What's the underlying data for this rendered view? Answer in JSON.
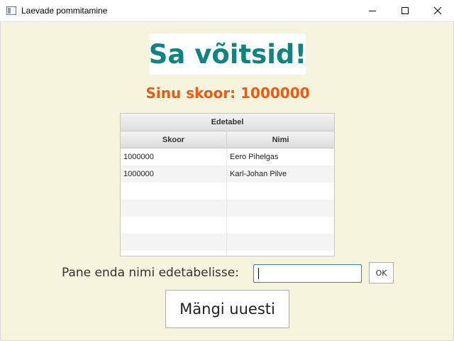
{
  "window": {
    "title": "Laevade pommitamine",
    "icon": "app-window-icon",
    "controls": [
      "minimize-icon",
      "maximize-icon",
      "close-icon"
    ]
  },
  "result": {
    "heading": "Sa võitsid!",
    "score_line": "Sinu skoor: 1000000"
  },
  "leaderboard": {
    "title": "Edetabel",
    "columns": [
      "Skoor",
      "Nimi"
    ],
    "rows": [
      [
        "1000000",
        "Eero Pihelgas"
      ],
      [
        "1000000",
        "Karl-Johan Pilve"
      ],
      [
        "",
        ""
      ],
      [
        "",
        ""
      ],
      [
        "",
        ""
      ],
      [
        "",
        ""
      ],
      [
        "",
        ""
      ]
    ]
  },
  "name_entry": {
    "label": "Pane enda nimi edetabelisse:",
    "value": "",
    "ok_label": "OK"
  },
  "play_again_label": "Mängi uuesti",
  "colors": {
    "background": "#f5f4dc",
    "heading": "#0f8480",
    "score": "#f05a10",
    "input_focus": "#3d7bbf"
  }
}
